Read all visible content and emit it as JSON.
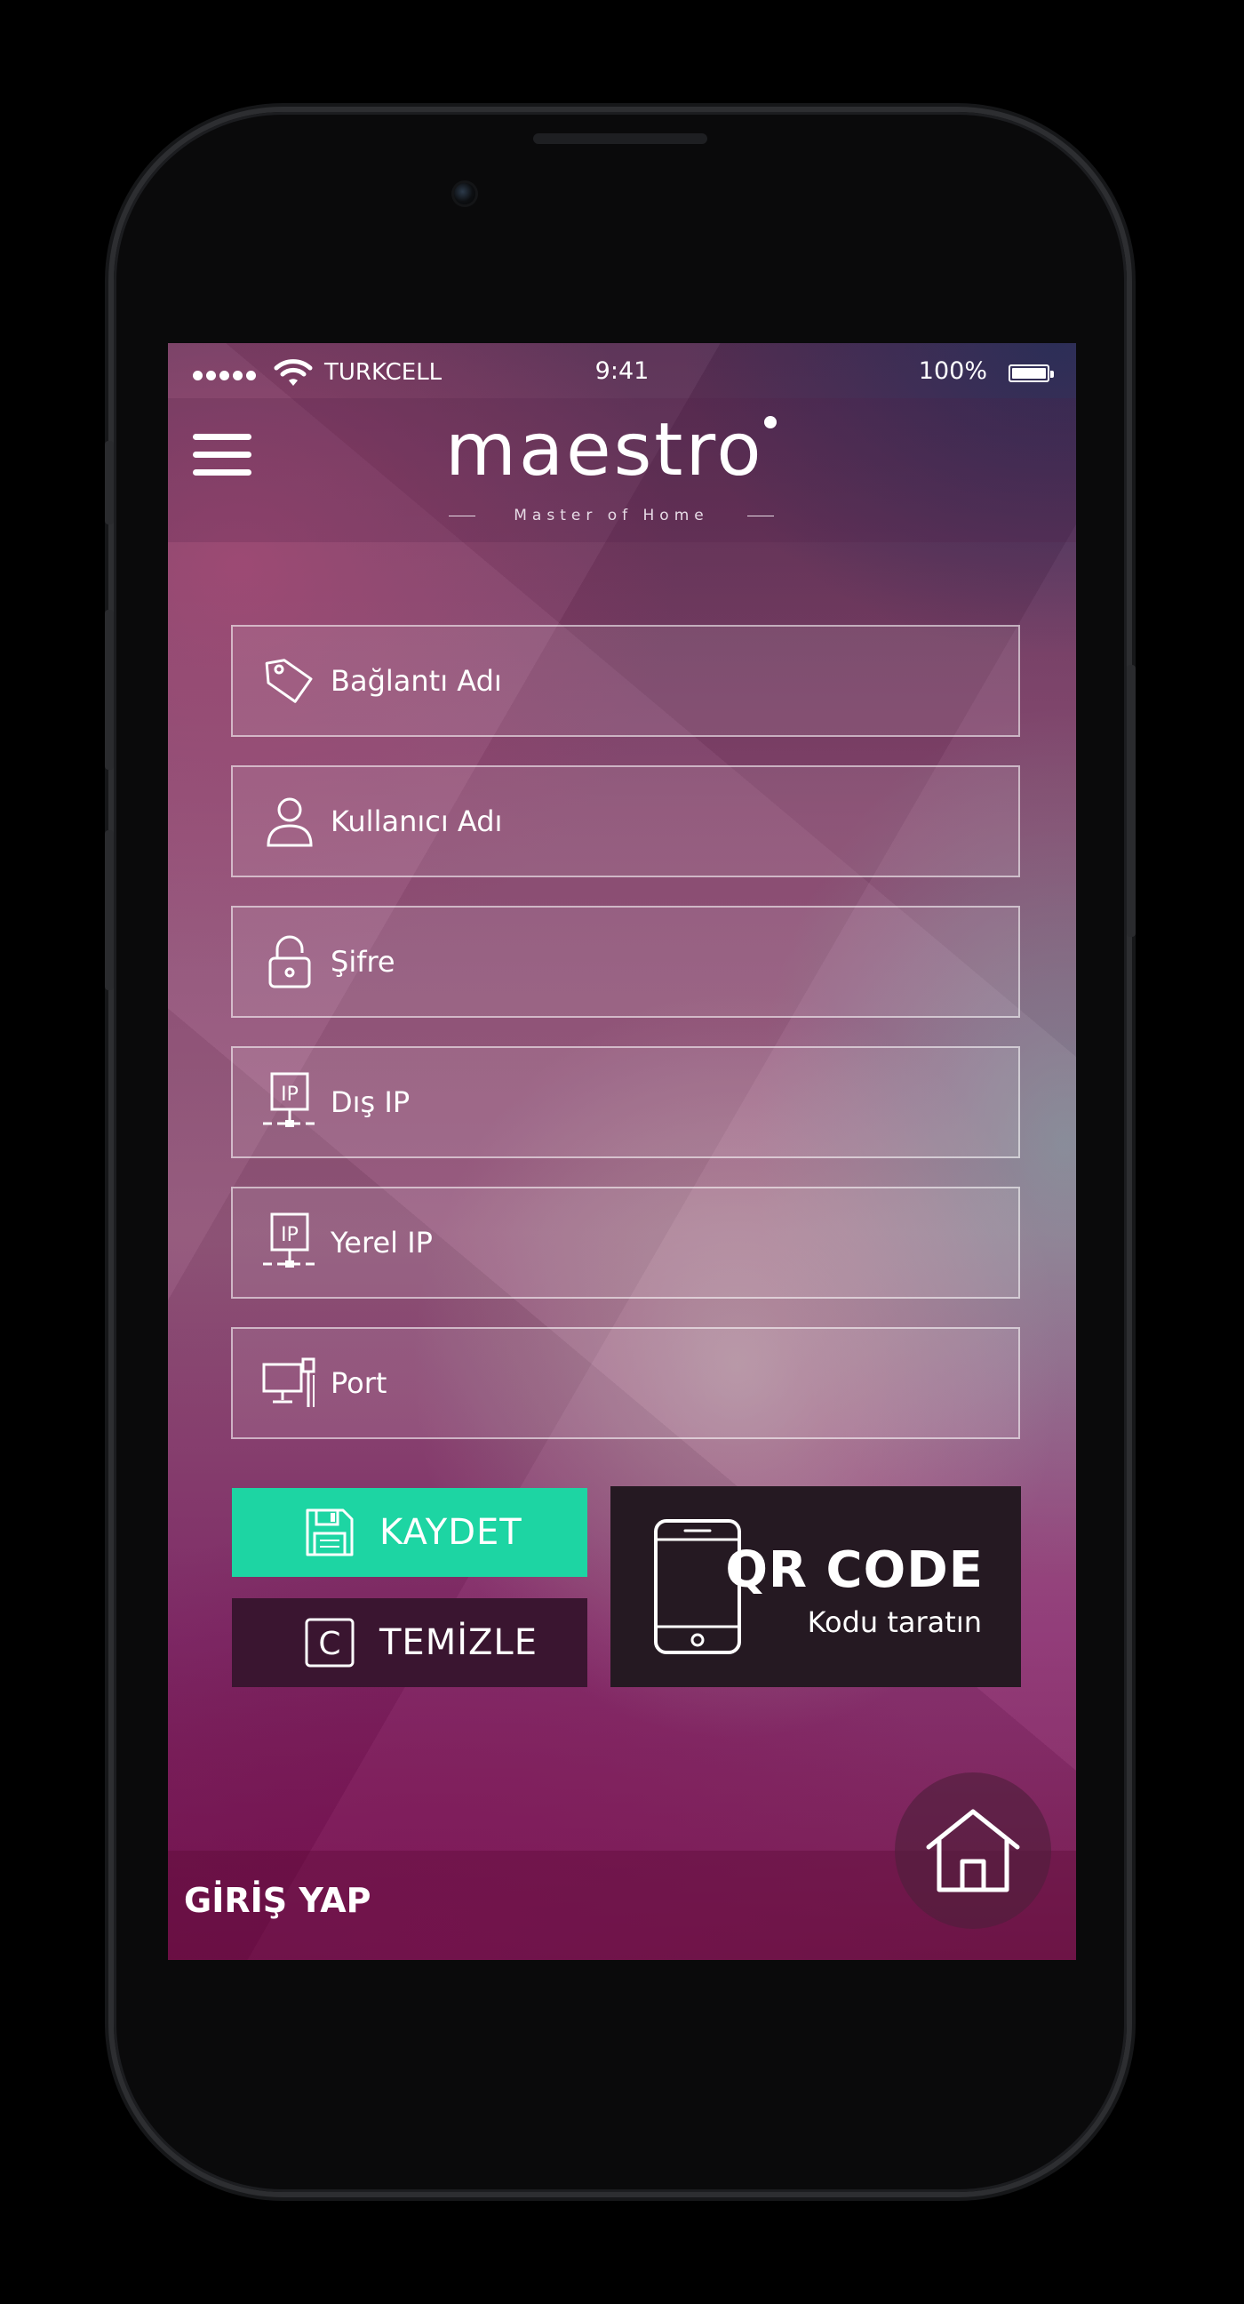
{
  "status_bar": {
    "carrier": "TURKCELL",
    "time": "9:41",
    "battery": "100%"
  },
  "header": {
    "logo": "maestro",
    "tagline": "Master of Home"
  },
  "form": {
    "connection_name": {
      "placeholder": "Bağlantı Adı",
      "icon": "tag-icon"
    },
    "username": {
      "placeholder": "Kullanıcı Adı",
      "icon": "user-icon"
    },
    "password": {
      "placeholder": "Şifre",
      "icon": "lock-icon"
    },
    "external_ip": {
      "placeholder": "Dış IP",
      "icon": "ip-network-icon"
    },
    "local_ip": {
      "placeholder": "Yerel IP",
      "icon": "ip-network-icon"
    },
    "port": {
      "placeholder": "Port",
      "icon": "computer-port-icon"
    }
  },
  "actions": {
    "save": {
      "label": "KAYDET",
      "icon": "floppy-disk-icon",
      "color": "#1dd5a3"
    },
    "clear": {
      "label": "TEMİZLE",
      "icon": "clear-c-icon",
      "color": "#3a1530"
    },
    "qr": {
      "title": "QR CODE",
      "subtitle": "Kodu taratın",
      "icon": "smartphone-icon"
    }
  },
  "footer": {
    "login": "GİRİŞ YAP",
    "home_icon": "home-icon"
  }
}
